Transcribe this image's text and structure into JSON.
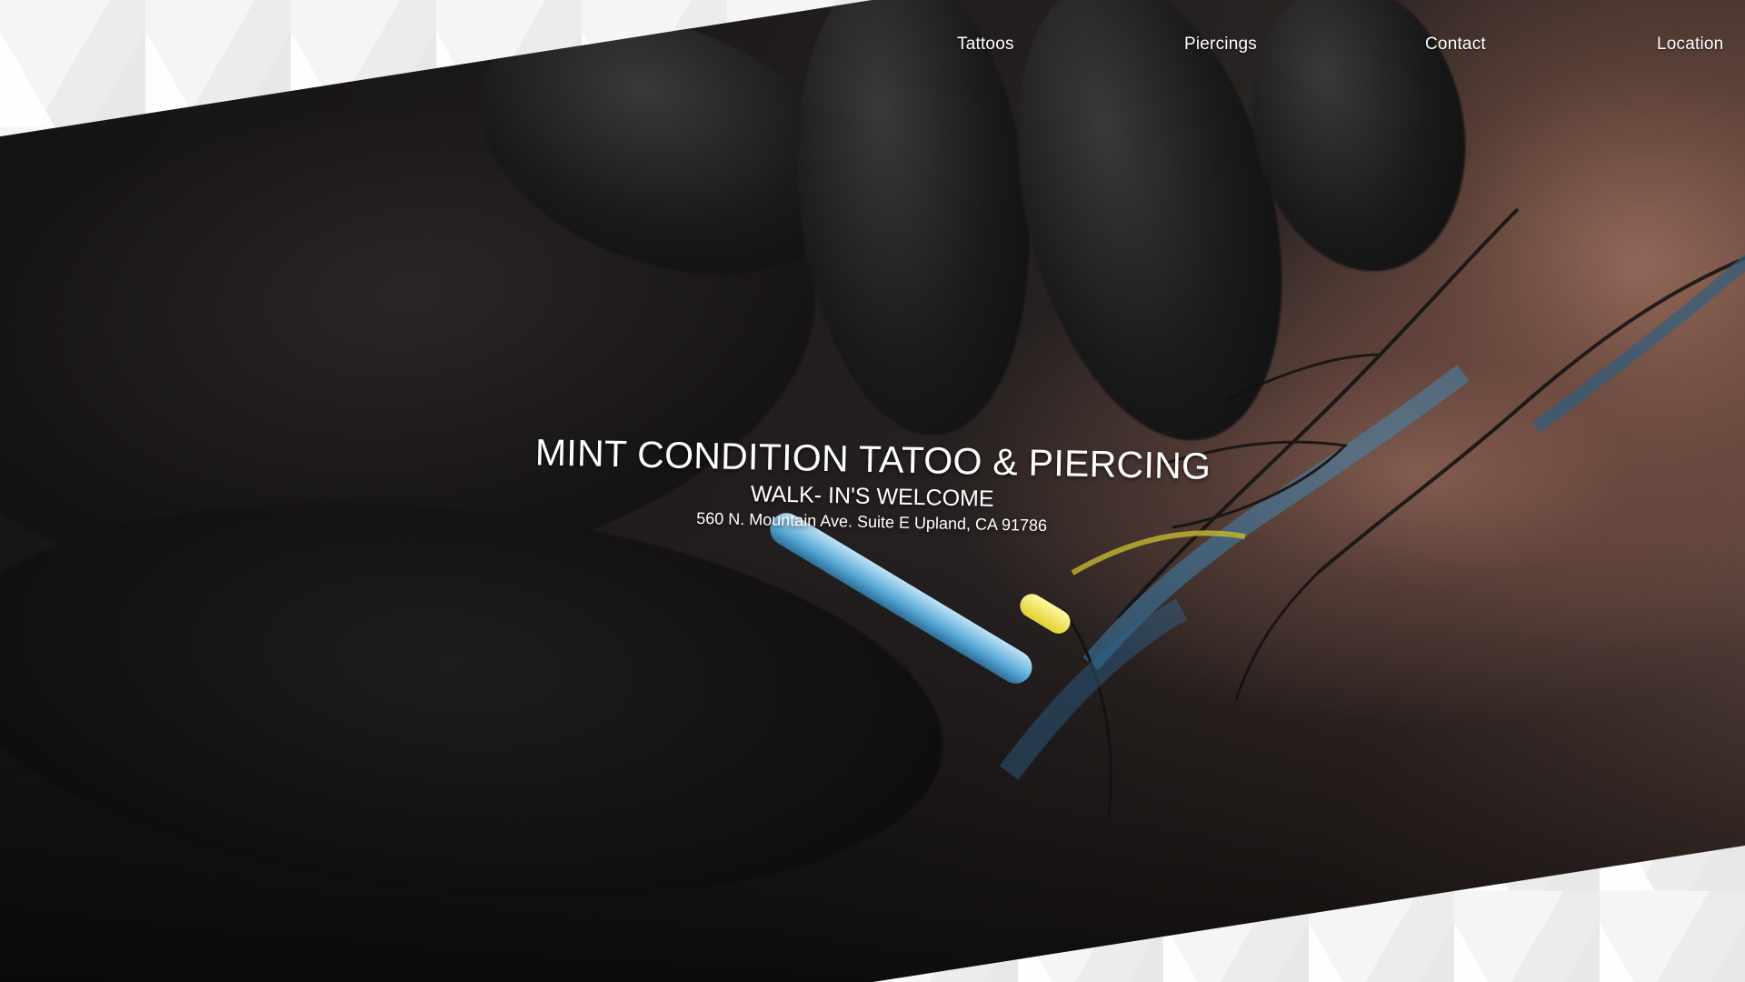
{
  "nav": {
    "items": [
      {
        "label": "Tattoos"
      },
      {
        "label": "Piercings"
      },
      {
        "label": "Contact"
      },
      {
        "label": "Location"
      }
    ]
  },
  "hero": {
    "title": "MINT CONDITION TATOO & PIERCING",
    "subtitle": "WALK- IN'S WELCOME",
    "address": "560 N. Mountain Ave. Suite E Upland, CA 91786"
  },
  "colors": {
    "text": "#ffffff",
    "background_light": "#f3f3f3",
    "hero_dark": "#141212",
    "needle_blue": "#5aaad8",
    "needle_tip_yellow": "#e0d230"
  }
}
